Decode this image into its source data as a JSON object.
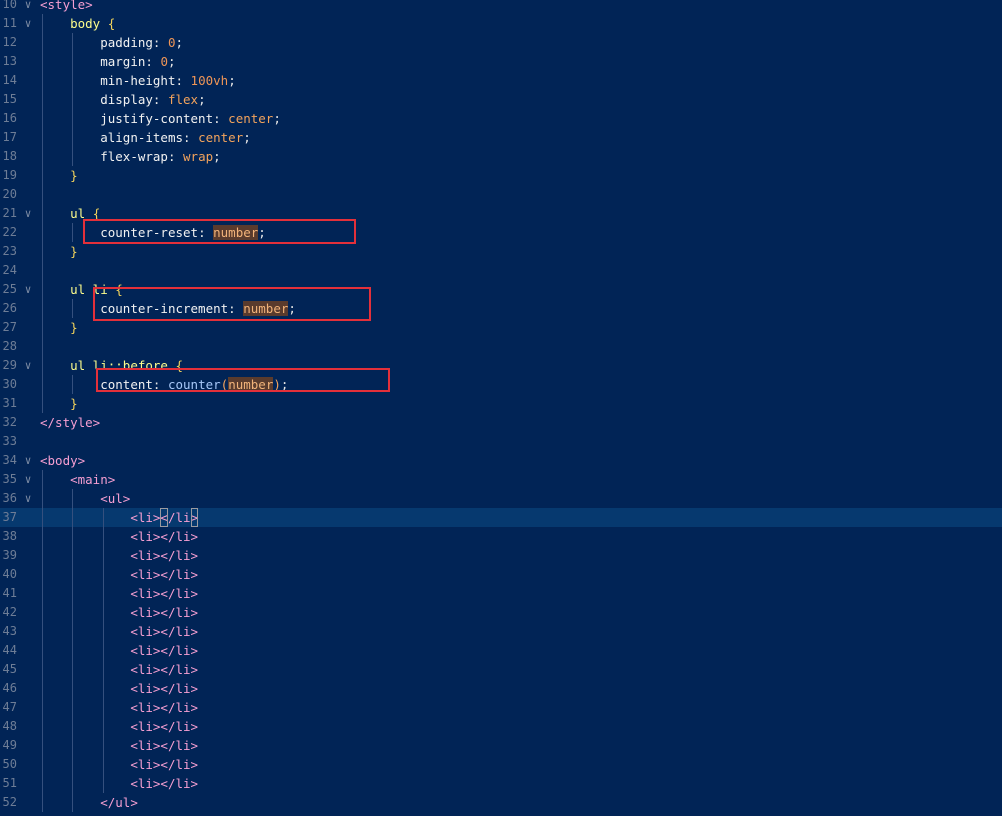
{
  "editor": {
    "lines": [
      {
        "num": "10",
        "fold": true,
        "tokens": [
          {
            "t": "<style>",
            "c": "tag"
          }
        ]
      },
      {
        "num": "11",
        "fold": true,
        "tokens": [
          {
            "t": "    "
          },
          {
            "t": "body",
            "c": "sel"
          },
          {
            "t": " "
          },
          {
            "t": "{",
            "c": "brace"
          }
        ]
      },
      {
        "num": "12",
        "tokens": [
          {
            "t": "        "
          },
          {
            "t": "padding",
            "c": "prop"
          },
          {
            "t": ": ",
            "c": "punc"
          },
          {
            "t": "0",
            "c": "num"
          },
          {
            "t": ";",
            "c": "punc"
          }
        ]
      },
      {
        "num": "13",
        "tokens": [
          {
            "t": "        "
          },
          {
            "t": "margin",
            "c": "prop"
          },
          {
            "t": ": ",
            "c": "punc"
          },
          {
            "t": "0",
            "c": "num"
          },
          {
            "t": ";",
            "c": "punc"
          }
        ]
      },
      {
        "num": "14",
        "tokens": [
          {
            "t": "        "
          },
          {
            "t": "min-height",
            "c": "prop"
          },
          {
            "t": ": ",
            "c": "punc"
          },
          {
            "t": "100vh",
            "c": "num"
          },
          {
            "t": ";",
            "c": "punc"
          }
        ]
      },
      {
        "num": "15",
        "tokens": [
          {
            "t": "        "
          },
          {
            "t": "display",
            "c": "prop"
          },
          {
            "t": ": ",
            "c": "punc"
          },
          {
            "t": "flex",
            "c": "val"
          },
          {
            "t": ";",
            "c": "punc"
          }
        ]
      },
      {
        "num": "16",
        "tokens": [
          {
            "t": "        "
          },
          {
            "t": "justify-content",
            "c": "prop"
          },
          {
            "t": ": ",
            "c": "punc"
          },
          {
            "t": "center",
            "c": "val"
          },
          {
            "t": ";",
            "c": "punc"
          }
        ]
      },
      {
        "num": "17",
        "tokens": [
          {
            "t": "        "
          },
          {
            "t": "align-items",
            "c": "prop"
          },
          {
            "t": ": ",
            "c": "punc"
          },
          {
            "t": "center",
            "c": "val"
          },
          {
            "t": ";",
            "c": "punc"
          }
        ]
      },
      {
        "num": "18",
        "tokens": [
          {
            "t": "        "
          },
          {
            "t": "flex-wrap",
            "c": "prop"
          },
          {
            "t": ": ",
            "c": "punc"
          },
          {
            "t": "wrap",
            "c": "val"
          },
          {
            "t": ";",
            "c": "punc"
          }
        ]
      },
      {
        "num": "19",
        "tokens": [
          {
            "t": "    "
          },
          {
            "t": "}",
            "c": "brace"
          }
        ]
      },
      {
        "num": "20",
        "tokens": []
      },
      {
        "num": "21",
        "fold": true,
        "tokens": [
          {
            "t": "    "
          },
          {
            "t": "ul",
            "c": "sel"
          },
          {
            "t": " "
          },
          {
            "t": "{",
            "c": "brace"
          }
        ]
      },
      {
        "num": "22",
        "tokens": [
          {
            "t": "        "
          },
          {
            "t": "counter-reset",
            "c": "prop"
          },
          {
            "t": ": ",
            "c": "punc"
          },
          {
            "t": "number",
            "c": "hl"
          },
          {
            "t": ";",
            "c": "punc"
          }
        ]
      },
      {
        "num": "23",
        "tokens": [
          {
            "t": "    "
          },
          {
            "t": "}",
            "c": "brace"
          }
        ]
      },
      {
        "num": "24",
        "tokens": []
      },
      {
        "num": "25",
        "fold": true,
        "tokens": [
          {
            "t": "    "
          },
          {
            "t": "ul li",
            "c": "sel"
          },
          {
            "t": " "
          },
          {
            "t": "{",
            "c": "brace"
          }
        ]
      },
      {
        "num": "26",
        "tokens": [
          {
            "t": "        "
          },
          {
            "t": "counter-increment",
            "c": "prop"
          },
          {
            "t": ": ",
            "c": "punc"
          },
          {
            "t": "number",
            "c": "hl"
          },
          {
            "t": ";",
            "c": "punc"
          }
        ]
      },
      {
        "num": "27",
        "tokens": [
          {
            "t": "    "
          },
          {
            "t": "}",
            "c": "brace"
          }
        ]
      },
      {
        "num": "28",
        "tokens": []
      },
      {
        "num": "29",
        "fold": true,
        "tokens": [
          {
            "t": "    "
          },
          {
            "t": "ul li::before",
            "c": "sel"
          },
          {
            "t": " "
          },
          {
            "t": "{",
            "c": "brace"
          }
        ]
      },
      {
        "num": "30",
        "tokens": [
          {
            "t": "        "
          },
          {
            "t": "content",
            "c": "prop"
          },
          {
            "t": ": ",
            "c": "punc"
          },
          {
            "t": "counter",
            "c": "fn"
          },
          {
            "t": "(",
            "c": "val"
          },
          {
            "t": "number",
            "c": "hl"
          },
          {
            "t": ")",
            "c": "val"
          },
          {
            "t": ";",
            "c": "punc"
          }
        ]
      },
      {
        "num": "31",
        "tokens": [
          {
            "t": "    "
          },
          {
            "t": "}",
            "c": "brace"
          }
        ]
      },
      {
        "num": "32",
        "tokens": [
          {
            "t": "</style>",
            "c": "tag"
          }
        ]
      },
      {
        "num": "33",
        "tokens": []
      },
      {
        "num": "34",
        "fold": true,
        "tokens": [
          {
            "t": "<body>",
            "c": "tag"
          }
        ]
      },
      {
        "num": "35",
        "fold": true,
        "tokens": [
          {
            "t": "    "
          },
          {
            "t": "<main>",
            "c": "tag"
          }
        ]
      },
      {
        "num": "36",
        "fold": true,
        "tokens": [
          {
            "t": "        "
          },
          {
            "t": "<ul>",
            "c": "tag"
          }
        ]
      },
      {
        "num": "37",
        "active": true,
        "tokens": [
          {
            "t": "            "
          },
          {
            "t": "<li>",
            "c": "tag"
          },
          {
            "t": "<",
            "c": "caret"
          },
          {
            "t": "/li",
            "c": "tag"
          },
          {
            "t": ">",
            "c": "caret"
          }
        ]
      },
      {
        "num": "38",
        "tokens": [
          {
            "t": "            "
          },
          {
            "t": "<li></li>",
            "c": "tag"
          }
        ]
      },
      {
        "num": "39",
        "tokens": [
          {
            "t": "            "
          },
          {
            "t": "<li></li>",
            "c": "tag"
          }
        ]
      },
      {
        "num": "40",
        "tokens": [
          {
            "t": "            "
          },
          {
            "t": "<li></li>",
            "c": "tag"
          }
        ]
      },
      {
        "num": "41",
        "tokens": [
          {
            "t": "            "
          },
          {
            "t": "<li></li>",
            "c": "tag"
          }
        ]
      },
      {
        "num": "42",
        "tokens": [
          {
            "t": "            "
          },
          {
            "t": "<li></li>",
            "c": "tag"
          }
        ]
      },
      {
        "num": "43",
        "tokens": [
          {
            "t": "            "
          },
          {
            "t": "<li></li>",
            "c": "tag"
          }
        ]
      },
      {
        "num": "44",
        "tokens": [
          {
            "t": "            "
          },
          {
            "t": "<li></li>",
            "c": "tag"
          }
        ]
      },
      {
        "num": "45",
        "tokens": [
          {
            "t": "            "
          },
          {
            "t": "<li></li>",
            "c": "tag"
          }
        ]
      },
      {
        "num": "46",
        "tokens": [
          {
            "t": "            "
          },
          {
            "t": "<li></li>",
            "c": "tag"
          }
        ]
      },
      {
        "num": "47",
        "tokens": [
          {
            "t": "            "
          },
          {
            "t": "<li></li>",
            "c": "tag"
          }
        ]
      },
      {
        "num": "48",
        "tokens": [
          {
            "t": "            "
          },
          {
            "t": "<li></li>",
            "c": "tag"
          }
        ]
      },
      {
        "num": "49",
        "tokens": [
          {
            "t": "            "
          },
          {
            "t": "<li></li>",
            "c": "tag"
          }
        ]
      },
      {
        "num": "50",
        "tokens": [
          {
            "t": "            "
          },
          {
            "t": "<li></li>",
            "c": "tag"
          }
        ]
      },
      {
        "num": "51",
        "tokens": [
          {
            "t": "            "
          },
          {
            "t": "<li></li>",
            "c": "tag"
          }
        ]
      },
      {
        "num": "52",
        "tokens": [
          {
            "t": "        "
          },
          {
            "t": "</ul>",
            "c": "tag"
          }
        ]
      }
    ],
    "annotations": [
      {
        "line": "22",
        "label": "counter-reset"
      },
      {
        "line": "26",
        "label": "counter-increment"
      },
      {
        "line": "30",
        "label": "content"
      }
    ],
    "colors": {
      "background": "#012456",
      "active_line": "#06396f",
      "annotation_border": "#e3303a",
      "tag": "#f69fd2",
      "selector": "#fdfd8c",
      "value": "#f3a35c"
    },
    "icons": {
      "fold": "chevron-down-icon"
    }
  }
}
